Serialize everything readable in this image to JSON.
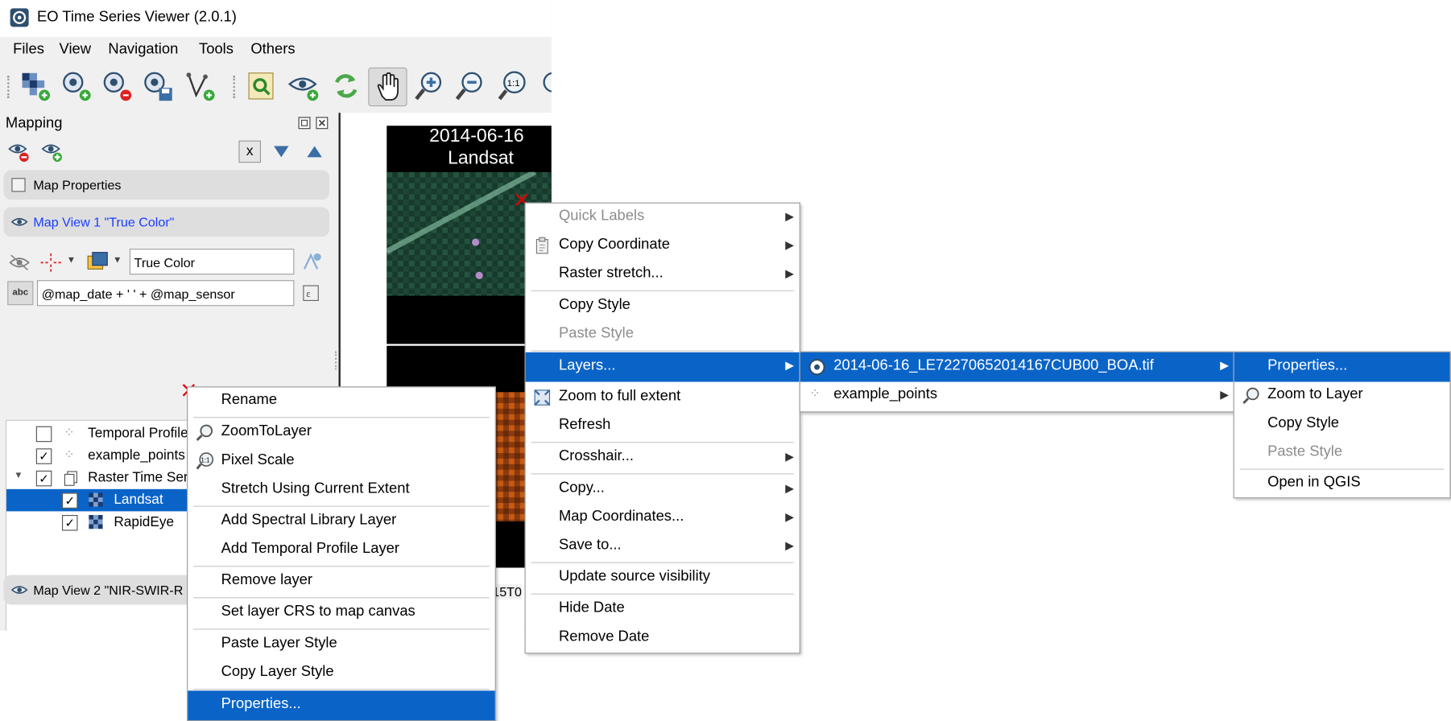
{
  "window": {
    "title": "EO Time Series Viewer (2.0.1)"
  },
  "menubar": {
    "items": [
      "Files",
      "View",
      "Navigation",
      "Tools",
      "Others"
    ]
  },
  "toolbar": {
    "icons": [
      "add-raster-icon",
      "add-sensor-icon",
      "remove-sensor-icon",
      "save-icon",
      "add-vector-icon",
      "zoom-layer-icon",
      "add-view-icon",
      "refresh-icon",
      "pan-icon",
      "zoom-in-icon",
      "zoom-out-icon",
      "zoom-pixel-icon",
      "more-icon"
    ]
  },
  "panel": {
    "title": "Mapping",
    "x_button": "x",
    "map_properties": "Map Properties",
    "map_view_1": "Map View 1 \"True Color\"",
    "map_view_2": "Map View 2 \"NIR-SWIR-R",
    "style_name": "True Color",
    "label_expression": "@map_date + ' ' + @map_sensor",
    "abc": "abc"
  },
  "layer_tree": [
    {
      "label": "Temporal Profiles",
      "checked": false
    },
    {
      "label": "example_points",
      "checked": true
    },
    {
      "label": "Raster Time Series",
      "checked": true
    },
    {
      "label": "Landsat",
      "checked": true
    },
    {
      "label": "RapidEye",
      "checked": true
    }
  ],
  "map": {
    "date": "2014-06-16",
    "sensor": "Landsat",
    "partial_label": "15T0"
  },
  "layer_context_menu": {
    "items": [
      "Rename",
      "ZoomToLayer",
      "Pixel Scale",
      "Stretch Using Current Extent",
      "Add Spectral Library Layer",
      "Add Temporal Profile Layer",
      "Remove layer",
      "Set layer CRS to map canvas",
      "Paste Layer Style",
      "Copy Layer Style",
      "Properties..."
    ]
  },
  "map_context_menu": {
    "items": [
      "Quick Labels",
      "Copy Coordinate",
      "Raster stretch...",
      "Copy Style",
      "Paste Style",
      "Layers...",
      "Zoom to full extent",
      "Refresh",
      "Crosshair...",
      "Copy...",
      "Map Coordinates...",
      "Save to...",
      "Update source visibility",
      "Hide Date",
      "Remove Date"
    ]
  },
  "layers_submenu": {
    "items": [
      "2014-06-16_LE72270652014167CUB00_BOA.tif",
      "example_points"
    ]
  },
  "layer_submenu": {
    "items": [
      "Properties...",
      "Zoom to Layer",
      "Copy Style",
      "Paste Style",
      "Open in QGIS"
    ]
  },
  "colors": {
    "highlight": "#0a64c8",
    "disabled_text": "#8c8c8c",
    "marker": "#e00000"
  }
}
